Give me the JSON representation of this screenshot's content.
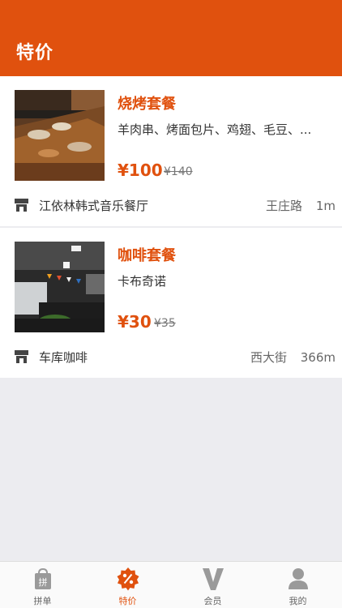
{
  "header": {
    "title": "特价"
  },
  "deals": [
    {
      "title": "烧烤套餐",
      "description": "羊肉串、烤面包片、鸡翅、毛豆、...",
      "price": "¥100",
      "original_price": "¥140",
      "store": "江依林韩式音乐餐厅",
      "street": "王庄路",
      "distance": "1m"
    },
    {
      "title": "咖啡套餐",
      "description": "卡布奇诺",
      "price": "¥30",
      "original_price": "¥35",
      "store": "车库咖啡",
      "street": "西大街",
      "distance": "366m"
    }
  ],
  "tabs": [
    {
      "label": "拼单",
      "icon": "shopping-bag-icon"
    },
    {
      "label": "特价",
      "icon": "discount-badge-icon"
    },
    {
      "label": "会员",
      "icon": "vip-v-icon"
    },
    {
      "label": "我的",
      "icon": "user-profile-icon"
    }
  ],
  "colors": {
    "accent": "#e0510e",
    "background": "#ececf0",
    "inactive_icon": "#9a9a9a"
  }
}
